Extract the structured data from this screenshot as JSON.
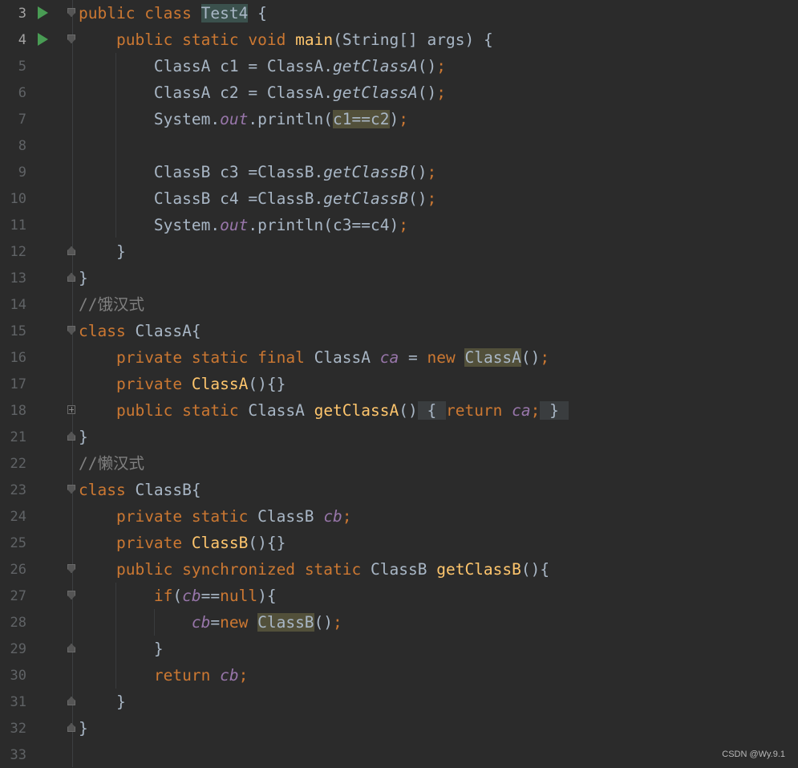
{
  "editor": {
    "lines": [
      {
        "n": "3"
      },
      {
        "n": "4"
      },
      {
        "n": "5"
      },
      {
        "n": "6"
      },
      {
        "n": "7"
      },
      {
        "n": "8"
      },
      {
        "n": "9"
      },
      {
        "n": "10"
      },
      {
        "n": "11"
      },
      {
        "n": "12"
      },
      {
        "n": "13"
      },
      {
        "n": "14"
      },
      {
        "n": "15"
      },
      {
        "n": "16"
      },
      {
        "n": "17"
      },
      {
        "n": "18"
      },
      {
        "n": "21"
      },
      {
        "n": "22"
      },
      {
        "n": "23"
      },
      {
        "n": "24"
      },
      {
        "n": "25"
      },
      {
        "n": "26"
      },
      {
        "n": "27"
      },
      {
        "n": "28"
      },
      {
        "n": "29"
      },
      {
        "n": "30"
      },
      {
        "n": "31"
      },
      {
        "n": "32"
      },
      {
        "n": "33"
      }
    ],
    "t": {
      "public": "public",
      "class": "class",
      "static": "static",
      "void": "void",
      "final": "final",
      "private": "private",
      "new": "new",
      "return": "return",
      "synchronized": "synchronized",
      "if": "if",
      "null": "null",
      "Test4": "Test4",
      "main": "main",
      "String": "String",
      "args": "args",
      "ClassA": "ClassA",
      "ClassB": "ClassB",
      "System": "System",
      "out": "out",
      "println": "println",
      "getClassA": "getClassA",
      "getClassB": "getClassB",
      "c1": "c1",
      "c2": "c2",
      "c3": "c3",
      "c4": "c4",
      "ca": "ca",
      "cb": "cb",
      "comment_hungry": "//饿汉式",
      "comment_lazy": "//懒汉式"
    }
  },
  "watermark": "CSDN @Wy.9.1"
}
